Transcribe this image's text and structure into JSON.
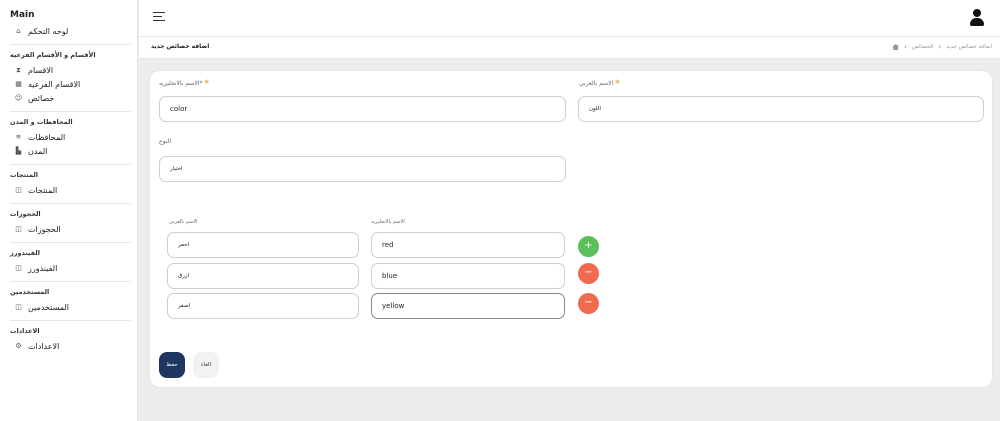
{
  "sidebar": {
    "main_label": "Main",
    "dashboard": {
      "label": "لوحه التحكم",
      "icon": "home-icon"
    },
    "groups": [
      {
        "title": "الأقسام و الأقسام الفرعيه",
        "items": [
          {
            "label": "الاقسام",
            "icon": "hourglass-icon"
          },
          {
            "label": "الاقسام الفرعيه",
            "icon": "calendar-icon"
          },
          {
            "label": "خصائص",
            "icon": "smile-icon"
          }
        ]
      },
      {
        "title": "المحافظات و المدن",
        "items": [
          {
            "label": "المحافظات",
            "icon": "layers-icon"
          },
          {
            "label": "المدن",
            "icon": "buildings-icon"
          }
        ]
      },
      {
        "title": "المنتجات",
        "items": [
          {
            "label": "المنتجات",
            "icon": "bookmark-icon"
          }
        ]
      },
      {
        "title": "الحجوزات",
        "items": [
          {
            "label": "الحجوزات",
            "icon": "bookmark-icon"
          }
        ]
      },
      {
        "title": "الفيندورز",
        "items": [
          {
            "label": "الفيندورز",
            "icon": "bookmark-icon"
          }
        ]
      },
      {
        "title": "المستخدمين",
        "items": [
          {
            "label": "المستخدمين",
            "icon": "bookmark-icon"
          }
        ]
      },
      {
        "title": "الاعدادات",
        "items": [
          {
            "label": "الاعدادات",
            "icon": "gear-icon"
          }
        ]
      }
    ]
  },
  "header": {
    "page_title": "اضافه خصائص جديد",
    "breadcrumb": [
      "الخصائص",
      "اضافه خصائص جديد"
    ]
  },
  "form": {
    "name_en_label": "الاسم بالانجليزيه",
    "name_en_value": "color",
    "name_ar_label": "الاسم بالعربي",
    "name_ar_value": "اللون",
    "type_label": "النوع",
    "type_value": "اختيار",
    "options_ar_header": "الاسم بالعربي",
    "options_en_header": "الاسم بالانجليزيه",
    "options": [
      {
        "ar": "احمر",
        "en": "red"
      },
      {
        "ar": "ازرق",
        "en": "blue"
      },
      {
        "ar": "اصفر",
        "en": "yellow"
      }
    ],
    "add_symbol": "+",
    "remove_symbol": "−",
    "save_label": "حفظ",
    "cancel_label": "الغاء"
  },
  "colors": {
    "primary": "#1f3660",
    "add": "#5cbf5c",
    "remove": "#ef6a4e",
    "required": "#f0a040"
  }
}
